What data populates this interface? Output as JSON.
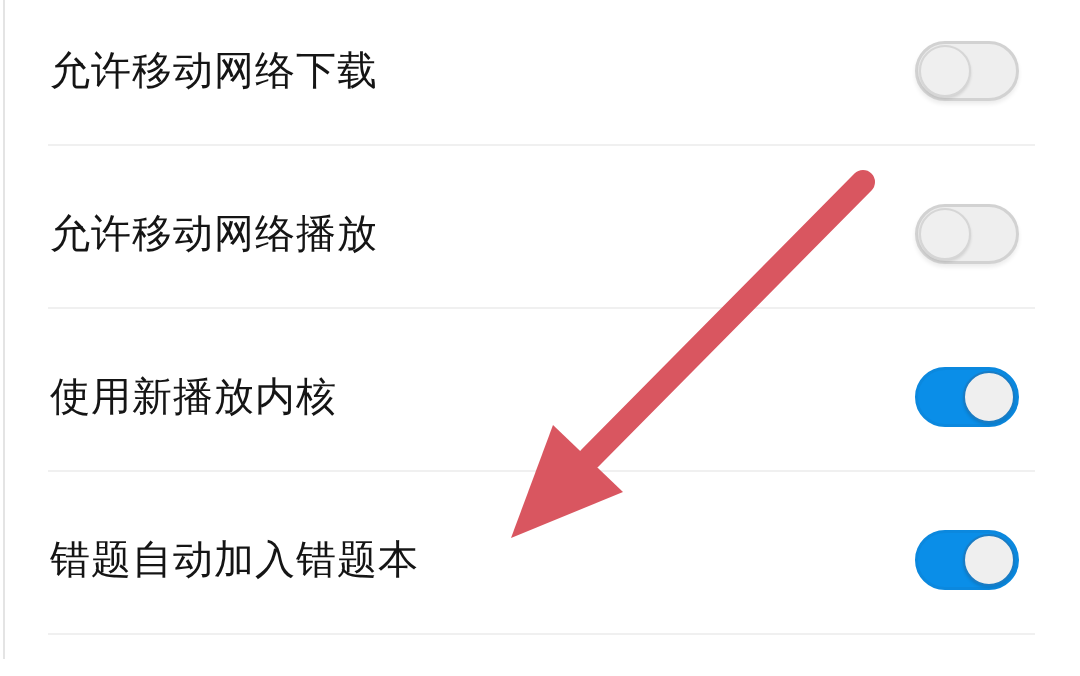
{
  "settings": [
    {
      "label": "允许移动网络下载",
      "on": false
    },
    {
      "label": "允许移动网络播放",
      "on": false
    },
    {
      "label": "使用新播放内核",
      "on": true
    },
    {
      "label": "错题自动加入错题本",
      "on": true
    }
  ]
}
